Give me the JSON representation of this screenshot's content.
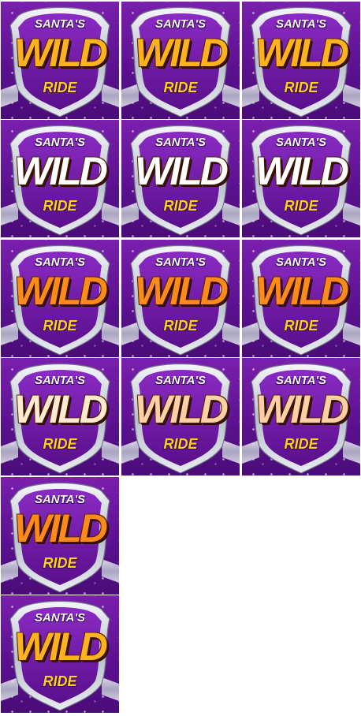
{
  "sheet": {
    "frames": [
      {
        "line1": "SANTA'S",
        "line2": "WILD",
        "line3": "RIDE",
        "wild_color": "#ffb21f"
      },
      {
        "line1": "SANTA'S",
        "line2": "WILD",
        "line3": "RIDE",
        "wild_color": "#ffb21f"
      },
      {
        "line1": "SANTA'S",
        "line2": "WILD",
        "line3": "RIDE",
        "wild_color": "#ffb21f"
      },
      {
        "line1": "SANTA'S",
        "line2": "WILD",
        "line3": "RIDE",
        "wild_color": "#ffffff"
      },
      {
        "line1": "SANTA'S",
        "line2": "WILD",
        "line3": "RIDE",
        "wild_color": "#ffffff"
      },
      {
        "line1": "SANTA'S",
        "line2": "WILD",
        "line3": "RIDE",
        "wild_color": "#ffffff"
      },
      {
        "line1": "SANTA'S",
        "line2": "WILD",
        "line3": "RIDE",
        "wild_color": "#ff8a1c"
      },
      {
        "line1": "SANTA'S",
        "line2": "WILD",
        "line3": "RIDE",
        "wild_color": "#ff8a1c"
      },
      {
        "line1": "SANTA'S",
        "line2": "WILD",
        "line3": "RIDE",
        "wild_color": "#ff8a1c"
      },
      {
        "line1": "SANTA'S",
        "line2": "WILD",
        "line3": "RIDE",
        "wild_color": "#ffe9cf"
      },
      {
        "line1": "SANTA'S",
        "line2": "WILD",
        "line3": "RIDE",
        "wild_color": "#ffd0a6"
      },
      {
        "line1": "SANTA'S",
        "line2": "WILD",
        "line3": "RIDE",
        "wild_color": "#ffd0a6"
      },
      {
        "line1": "SANTA'S",
        "line2": "WILD",
        "line3": "RIDE",
        "wild_color": "#ff8a1c"
      },
      {
        "line1": "SANTA'S",
        "line2": "WILD",
        "line3": "RIDE",
        "wild_color": "#ffb21f"
      }
    ],
    "colors": {
      "background": "#6a16a0",
      "badge_silver": "#d9dde6",
      "badge_purple": "#6b1aa3",
      "ride_yellow": "#ffd21a"
    }
  }
}
